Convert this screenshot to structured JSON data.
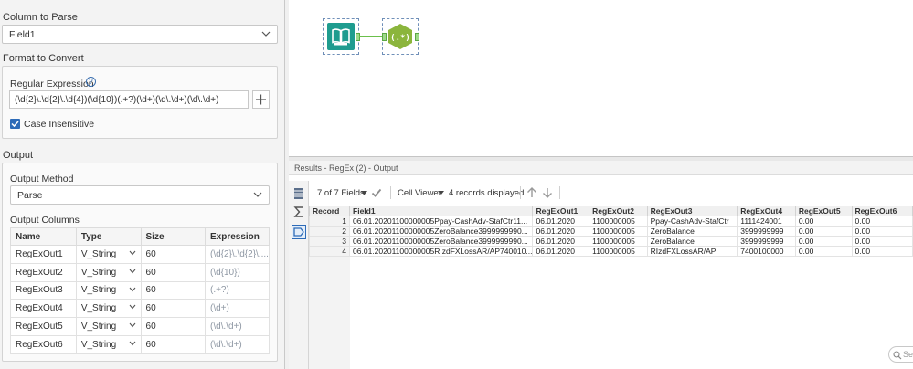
{
  "left_panel": {
    "column_to_parse": {
      "title": "Column to Parse",
      "value": "Field1"
    },
    "format_to_convert": {
      "title": "Format to Convert",
      "regex_label": "Regular Expression",
      "help_glyph": "?",
      "regex_value": "(\\d{2}\\.\\d{2}\\.\\d{4})(\\d{10})(.+?)(\\d+)(\\d\\.\\d+)(\\d\\.\\d+)",
      "plus_glyph": "+",
      "case_insensitive_label": "Case Insensitive",
      "case_insensitive_checked": true
    },
    "output": {
      "title": "Output",
      "method_label": "Output Method",
      "method_value": "Parse",
      "columns_label": "Output Columns",
      "headers": [
        "Name",
        "Type",
        "Size",
        "Expression"
      ],
      "rows": [
        {
          "name": "RegExOut1",
          "type": "V_String",
          "size": "60",
          "expression": "(\\d{2}\\.\\d{2}\\...."
        },
        {
          "name": "RegExOut2",
          "type": "V_String",
          "size": "60",
          "expression": "(\\d{10})"
        },
        {
          "name": "RegExOut3",
          "type": "V_String",
          "size": "60",
          "expression": "(.+?)"
        },
        {
          "name": "RegExOut4",
          "type": "V_String",
          "size": "60",
          "expression": "(\\d+)"
        },
        {
          "name": "RegExOut5",
          "type": "V_String",
          "size": "60",
          "expression": "(\\d\\.\\d+)"
        },
        {
          "name": "RegExOut6",
          "type": "V_String",
          "size": "60",
          "expression": "(\\d\\.\\d+)"
        }
      ]
    }
  },
  "canvas": {
    "tools": [
      {
        "name": "input-data-tool",
        "icon": "book-icon",
        "color": "#1e9c8f"
      },
      {
        "name": "regex-tool",
        "icon": "regex-icon",
        "color": "#8bb53c"
      }
    ],
    "connector_color": "#6bc04b"
  },
  "results": {
    "title": "Results - RegEx (2) - Output",
    "toolbar": {
      "fields_label": "7 of 7 Fields",
      "cell_viewer_label": "Cell Viewer",
      "records_label": "4 records displayed",
      "search_placeholder": "Sea"
    },
    "columns": [
      "Record",
      "Field1",
      "RegExOut1",
      "RegExOut2",
      "RegExOut3",
      "RegExOut4",
      "RegExOut5",
      "RegExOut6"
    ],
    "rows": [
      [
        "1",
        "06.01.20201100000005Ppay-CashAdv-StafCtr11...",
        "06.01.2020",
        "1100000005",
        "Ppay-CashAdv-StafCtr",
        "1111424001",
        "0.00",
        "0.00"
      ],
      [
        "2",
        "06.01.20201100000005ZeroBalance3999999990...",
        "06.01.2020",
        "1100000005",
        "ZeroBalance",
        "3999999999",
        "0.00",
        "0.00"
      ],
      [
        "3",
        "06.01.20201100000005ZeroBalance3999999990...",
        "06.01.2020",
        "1100000005",
        "ZeroBalance",
        "3999999999",
        "0.00",
        "0.00"
      ],
      [
        "4",
        "06.01.20201100000005RIzdFXLossAR/AP740010...",
        "06.01.2020",
        "1100000005",
        "RIzdFXLossAR/AP",
        "7400100000",
        "0.00",
        "0.00"
      ]
    ]
  }
}
